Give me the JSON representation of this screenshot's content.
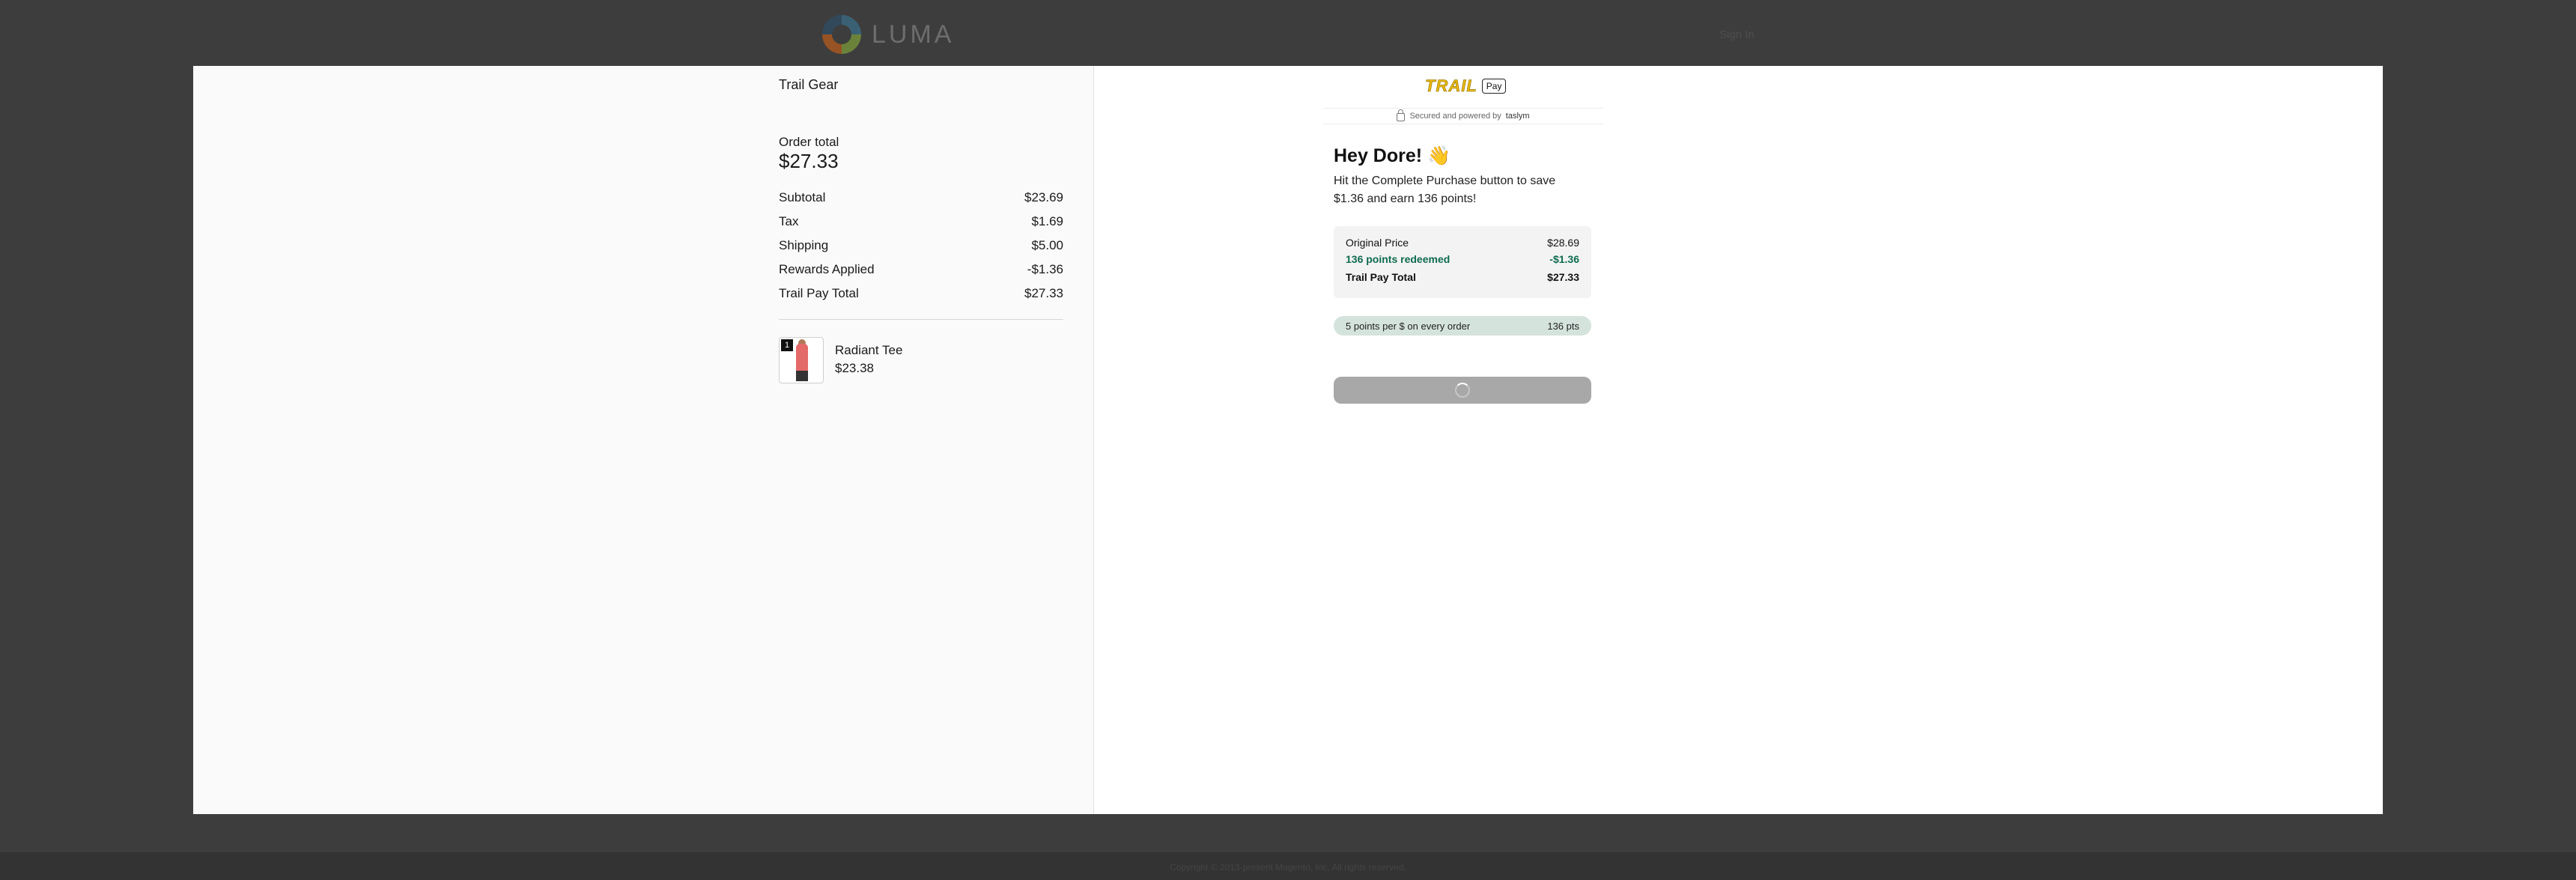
{
  "site": {
    "logo_text": "LUMA",
    "signin_label": "Sign In",
    "copyright": "Copyright © 2013-present Magento, Inc. All rights reserved."
  },
  "order": {
    "store_name": "Trail Gear",
    "total_label": "Order total",
    "total_value": "$27.33",
    "summary": [
      {
        "label": "Subtotal",
        "value": "$23.69"
      },
      {
        "label": "Tax",
        "value": "$1.69"
      },
      {
        "label": "Shipping",
        "value": "$5.00"
      },
      {
        "label": "Rewards Applied",
        "value": "-$1.36"
      },
      {
        "label": "Trail Pay Total",
        "value": "$27.33"
      }
    ],
    "items": [
      {
        "quantity": "1",
        "name": "Radiant Tee",
        "price": "$23.38"
      }
    ]
  },
  "checkout": {
    "brand_name": "TRAIL",
    "brand_badge": "Pay",
    "secured_text": "Secured and powered by",
    "powered_brand": "taslym",
    "greeting": "Hey Dore! 👋",
    "subtitle": "Hit the Complete Purchase button to save $1.36 and earn 136 points!",
    "price_breakdown": [
      {
        "label": "Original Price",
        "value": "$28.69"
      },
      {
        "label": "136 points redeemed",
        "value": "-$1.36"
      },
      {
        "label": "Trail Pay Total",
        "value": "$27.33"
      }
    ],
    "points_rate": "5 points per $ on every order",
    "points_earned": "136 pts"
  },
  "colors": {
    "brand_yellow": "#e8b90d",
    "redeemed_green": "#0e6b4e",
    "points_pill_bg": "#d5e3dd",
    "button_loading_gray": "#a8a8a8",
    "overlay": "#3d3d3d"
  }
}
